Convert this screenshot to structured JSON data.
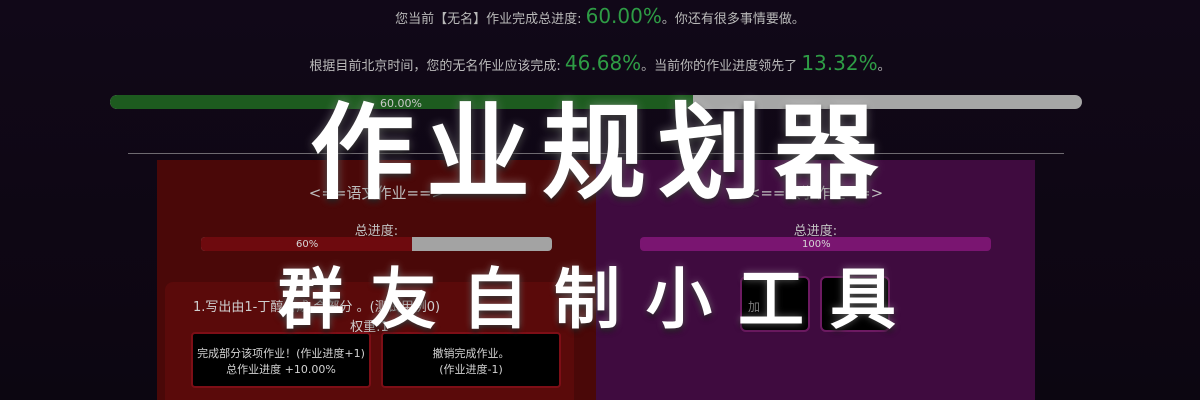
{
  "status": {
    "line1_prefix": "您当前【无名】作业完成总进度: ",
    "line1_pct": "60.00%",
    "line1_suffix": "。你还有很多事情要做。",
    "line2_prefix": "根据目前北京时间，您的无名作业应该完成: ",
    "line2_expected_pct": "46.68%",
    "line2_middle": "。当前你的作业进度领先了 ",
    "line2_lead_pct": "13.32%",
    "line2_suffix": "。"
  },
  "overall_progress": {
    "label": "60.00%",
    "value": 0.6
  },
  "subjects": {
    "chinese": {
      "title": "<==语文作业==>",
      "progress_label": "总进度:",
      "pct_label": "60%",
      "value": 0.6,
      "task": {
        "title": "1.写出由1-丁醇合成   合部分   。(测试用例0)",
        "weight": "权重:1",
        "partial_button": {
          "line1": "完成部分该项作业！(作业进度+1)",
          "line2": "总作业进度 +10.00%"
        },
        "revoke_button": {
          "line1": "撤销完成作业。",
          "line2": "(作业进度-1)"
        }
      }
    },
    "math": {
      "title": "<==数学作业==>",
      "progress_label": "总进度:",
      "pct_label": "100%",
      "value": 1.0,
      "buttons": [
        "加",
        ""
      ]
    }
  },
  "banner": {
    "title": "作业规划器",
    "subtitle": "群友自制小工具"
  },
  "colors": {
    "background": "#0d0612",
    "pct_green": "#2e9c45",
    "overall_fill": "#1d5b1f",
    "chinese_panel": "#4a0808",
    "math_panel": "#3f0b3f",
    "chinese_fill": "#6e0a0e",
    "math_fill": "#7a1571"
  }
}
